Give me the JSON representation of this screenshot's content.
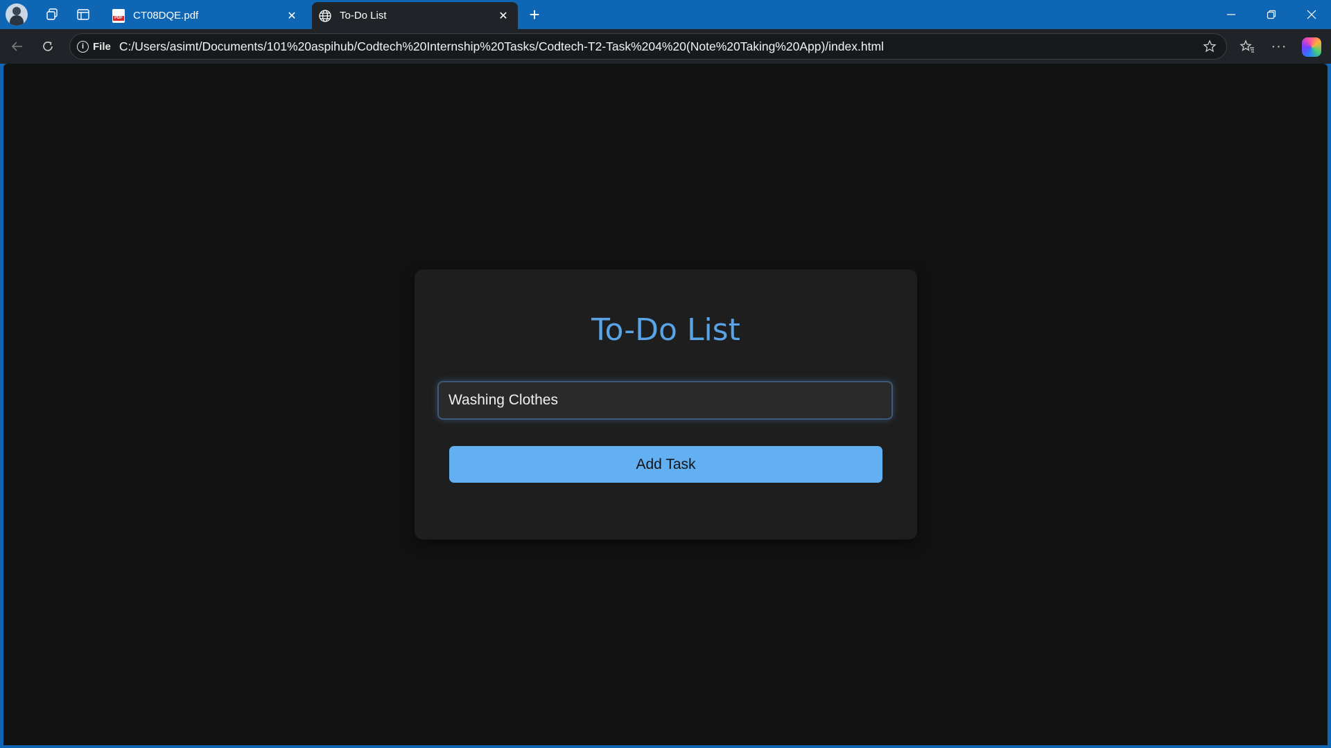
{
  "browser": {
    "tabs": [
      {
        "title": "CT08DQE.pdf",
        "favicon": "pdf-icon",
        "active": false
      },
      {
        "title": "To-Do List",
        "favicon": "globe-icon",
        "active": true
      }
    ],
    "address": {
      "scheme_label": "File",
      "url": "C:/Users/asimt/Documents/101%20aspihub/Codtech%20Internship%20Tasks/Codtech-T2-Task%204%20(Note%20Taking%20App)/index.html"
    }
  },
  "app": {
    "title": "To-Do List",
    "input": {
      "value": "Washing Clothes",
      "placeholder": ""
    },
    "add_button_label": "Add Task",
    "tasks": []
  },
  "colors": {
    "accent": "#5aa3e6",
    "button": "#62b0f2",
    "card": "#1e1e1e",
    "page": "#121212",
    "titlebar": "#0f66b5"
  }
}
